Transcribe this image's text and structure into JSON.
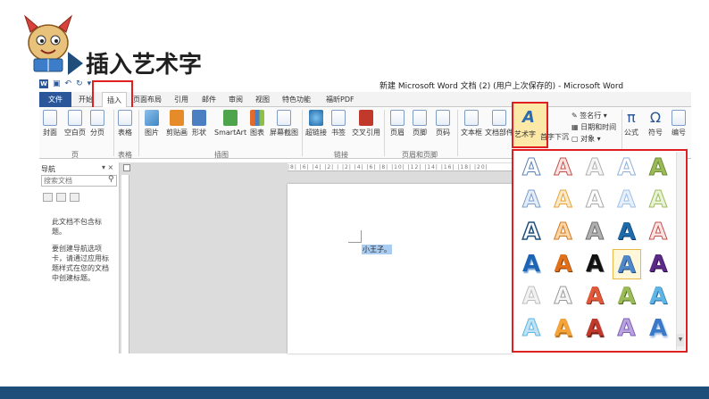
{
  "slide": {
    "title": "插入艺术字"
  },
  "window": {
    "title": "新建 Microsoft Word 文档 (2) (用户上次保存的) - Microsoft Word"
  },
  "tabs": [
    {
      "label": "文件"
    },
    {
      "label": "开始"
    },
    {
      "label": "插入"
    },
    {
      "label": "页面布局"
    },
    {
      "label": "引用"
    },
    {
      "label": "邮件"
    },
    {
      "label": "审阅"
    },
    {
      "label": "视图"
    },
    {
      "label": "特色功能"
    },
    {
      "label": "福昕PDF"
    }
  ],
  "ribbon": {
    "buttons": {
      "cover": "封面",
      "blank": "空白页",
      "pagebreak": "分页",
      "table": "表格",
      "picture": "图片",
      "clipart": "剪贴画",
      "shapes": "形状",
      "smartart": "SmartArt",
      "chart": "图表",
      "screenshot": "屏幕截图",
      "hyperlink": "超链接",
      "bookmark": "书签",
      "crossref": "交叉引用",
      "header": "页眉",
      "footer": "页脚",
      "pagenum": "页码",
      "textbox": "文本框",
      "docparts": "文档部件",
      "wordart": "艺术字",
      "dropcap": "首字下沉",
      "signature": "签名行",
      "datetime": "日期和时间",
      "object": "对象",
      "equation": "公式",
      "symbol": "符号",
      "number": "编号"
    },
    "groups": {
      "pages": "页",
      "tables": "表格",
      "illustrations": "插图",
      "links": "链接",
      "headerfooter": "页眉和页脚"
    }
  },
  "nav": {
    "title": "导航",
    "close": "▾ ×",
    "search_placeholder": "搜索文档",
    "message1": "此文档不包含标题。",
    "message2": "要创建导航选项卡，请通过应用标题样式在您的文档中创建标题。"
  },
  "document": {
    "text": "小王子。"
  },
  "ruler": {
    "marks": "|8| |6| |4| |2| | |2| |4| |6| |8| |10| |12| |14| |16| |18| |20|"
  },
  "gallery": {
    "glyph": "A",
    "selected_index": 18
  },
  "colors": {
    "accent": "#2b579a",
    "highlight": "#e02020",
    "footer": "#1f4e7a"
  }
}
